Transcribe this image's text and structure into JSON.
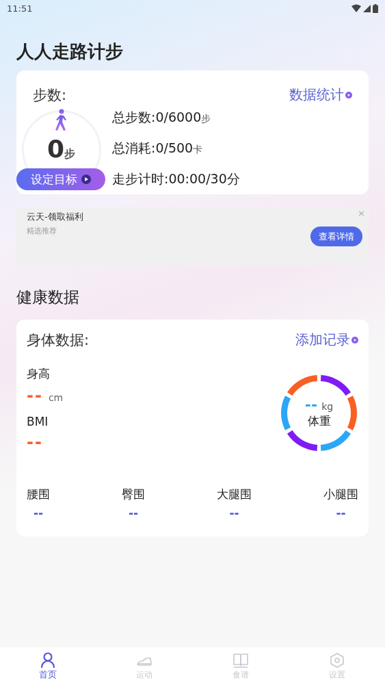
{
  "status_bar": {
    "time": "11:51"
  },
  "app_title": "人人走路计步",
  "steps_card": {
    "title": "步数:",
    "link": "数据统计",
    "count": "0",
    "count_unit": "步",
    "goal_button": "设定目标",
    "stats": [
      {
        "label": "总步数:",
        "value": "0/6000",
        "unit": "步"
      },
      {
        "label": "总消耗:",
        "value": "0/500",
        "unit": "卡"
      },
      {
        "label": "走步计时:",
        "value": "00:00/30分"
      }
    ]
  },
  "ad": {
    "title": "云天-领取福利",
    "subtitle": "精选推荐",
    "button": "查看详情",
    "close": "×"
  },
  "section_title": "健康数据",
  "body_card": {
    "title": "身体数据:",
    "link": "添加记录",
    "metrics": [
      {
        "label": "身高",
        "value": "--",
        "unit": "cm"
      },
      {
        "label": "BMI",
        "value": "--"
      }
    ],
    "weight": {
      "value": "--",
      "unit": "kg",
      "label": "体重"
    },
    "girths": [
      {
        "label": "腰围",
        "value": "--"
      },
      {
        "label": "臀围",
        "value": "--"
      },
      {
        "label": "大腿围",
        "value": "--"
      },
      {
        "label": "小腿围",
        "value": "--"
      }
    ]
  },
  "tabs": [
    {
      "label": "首页",
      "selected": true
    },
    {
      "label": "运动",
      "selected": false
    },
    {
      "label": "食谱",
      "selected": false
    },
    {
      "label": "设置",
      "selected": false
    }
  ]
}
